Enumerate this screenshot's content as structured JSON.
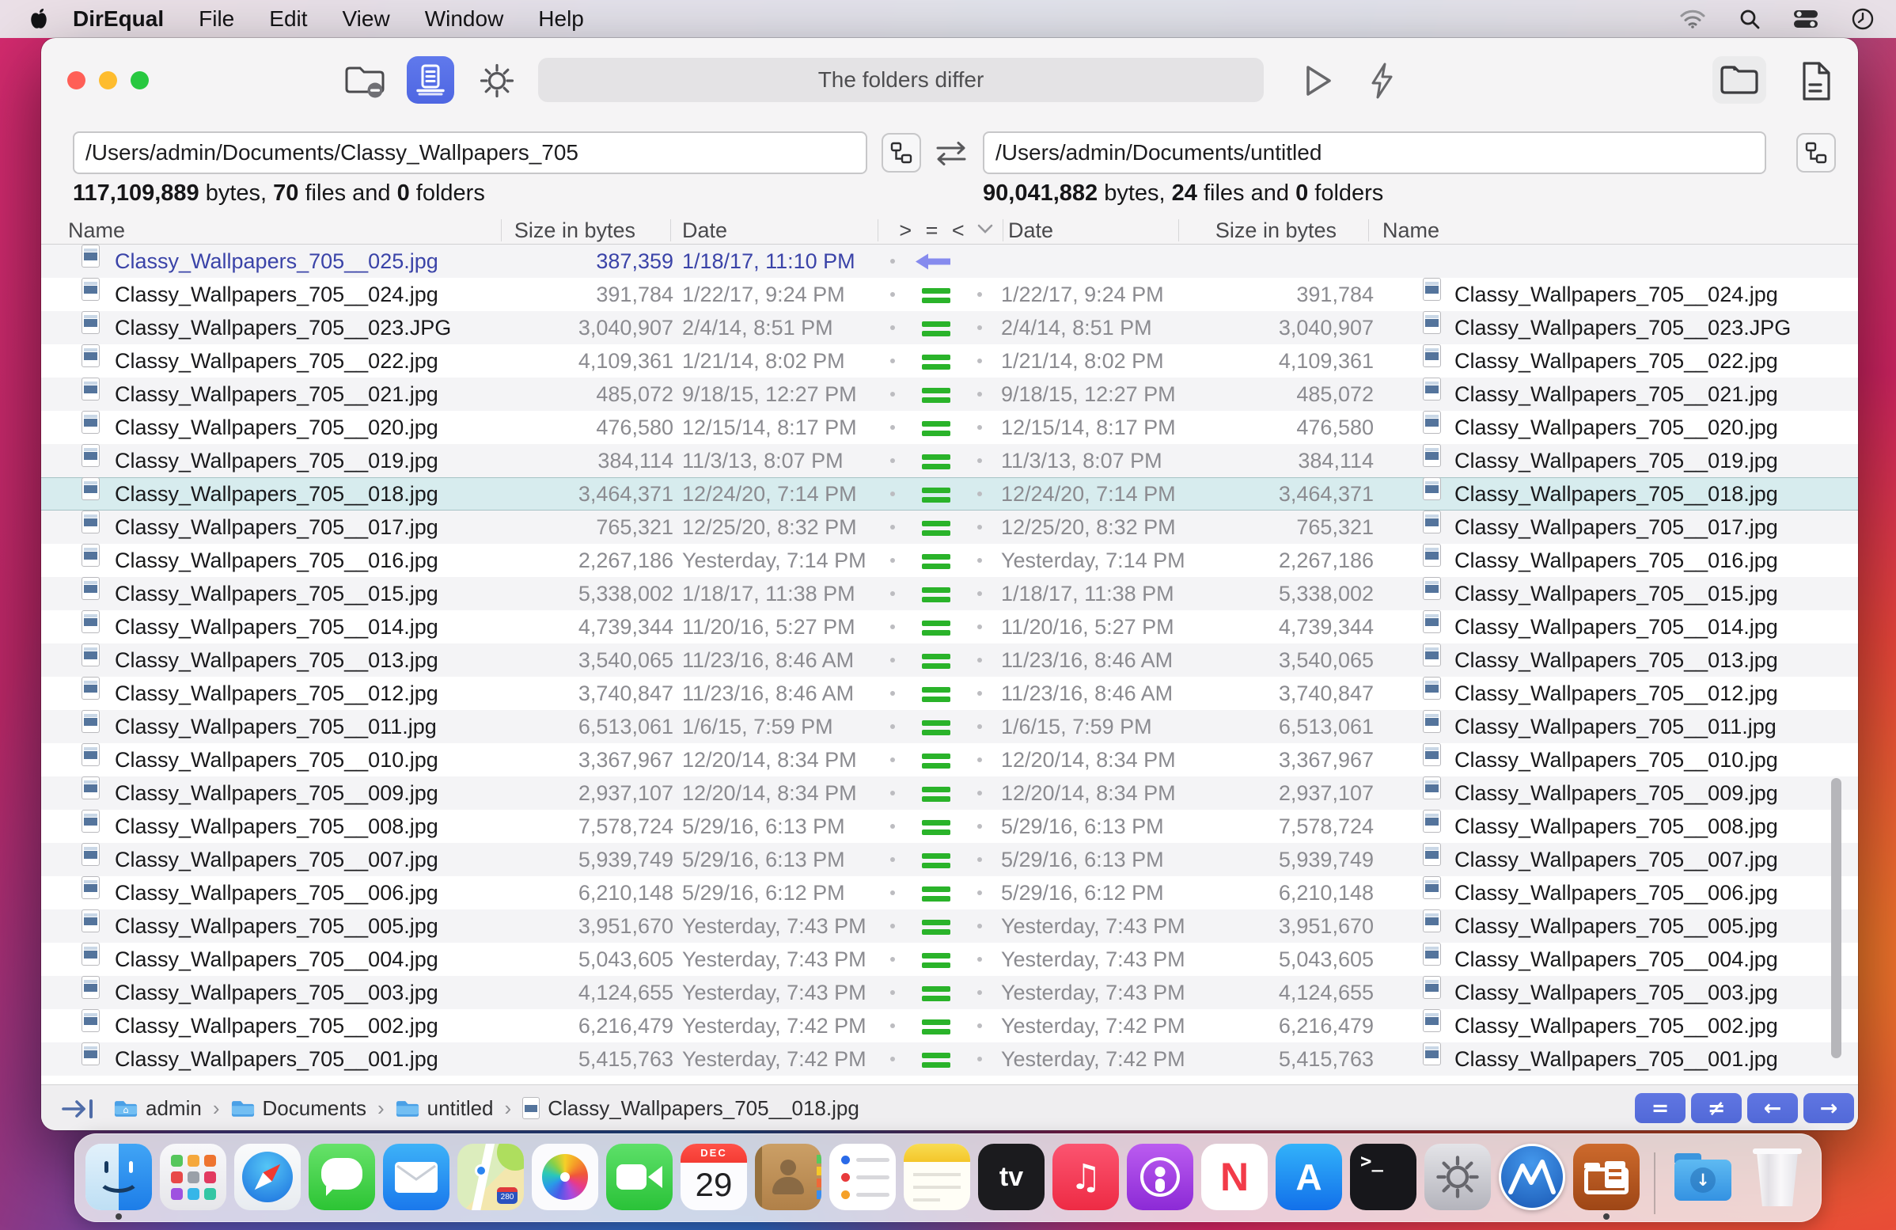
{
  "menu_bar": {
    "app_name": "DirEqual",
    "items": [
      "File",
      "Edit",
      "View",
      "Window",
      "Help"
    ],
    "status_icons": [
      "wifi-icon",
      "search-icon",
      "control-center-icon",
      "clock-icon"
    ]
  },
  "toolbar": {
    "status_text": "The folders differ",
    "icons": [
      "folder-minus-icon",
      "scan-compare-icon",
      "gear-icon",
      "play-icon",
      "lightning-icon",
      "open-folder-icon",
      "report-document-icon"
    ]
  },
  "left_pane": {
    "path": "/Users/admin/Documents/Classy_Wallpapers_705",
    "stats": {
      "bytes": "117,109,889",
      "files": "70",
      "folders": "0"
    }
  },
  "right_pane": {
    "path": "/Users/admin/Documents/untitled",
    "stats": {
      "bytes": "90,041,882",
      "files": "24",
      "folders": "0"
    }
  },
  "stats_words": {
    "bytes": "bytes,",
    "files": "files and",
    "folders": "folders"
  },
  "table": {
    "left_headers": [
      "Name",
      "Size in bytes",
      "Date"
    ],
    "compare_header": "> = <",
    "right_headers": [
      "Date",
      "Size in bytes",
      "Name"
    ],
    "rows": [
      {
        "name": "Classy_Wallpapers_705__025.jpg",
        "size": "387,359",
        "date": "1/18/17, 11:10 PM",
        "status": "left-only",
        "selected": false
      },
      {
        "name": "Classy_Wallpapers_705__024.jpg",
        "size": "391,784",
        "date": "1/22/17, 9:24 PM",
        "status": "equal",
        "selected": false
      },
      {
        "name": "Classy_Wallpapers_705__023.JPG",
        "size": "3,040,907",
        "date": "2/4/14, 8:51 PM",
        "status": "equal",
        "selected": false
      },
      {
        "name": "Classy_Wallpapers_705__022.jpg",
        "size": "4,109,361",
        "date": "1/21/14, 8:02 PM",
        "status": "equal",
        "selected": false
      },
      {
        "name": "Classy_Wallpapers_705__021.jpg",
        "size": "485,072",
        "date": "9/18/15, 12:27 PM",
        "status": "equal",
        "selected": false
      },
      {
        "name": "Classy_Wallpapers_705__020.jpg",
        "size": "476,580",
        "date": "12/15/14, 8:17 PM",
        "status": "equal",
        "selected": false
      },
      {
        "name": "Classy_Wallpapers_705__019.jpg",
        "size": "384,114",
        "date": "11/3/13, 8:07 PM",
        "status": "equal",
        "selected": false
      },
      {
        "name": "Classy_Wallpapers_705__018.jpg",
        "size": "3,464,371",
        "date": "12/24/20, 7:14 PM",
        "status": "equal",
        "selected": true
      },
      {
        "name": "Classy_Wallpapers_705__017.jpg",
        "size": "765,321",
        "date": "12/25/20, 8:32 PM",
        "status": "equal",
        "selected": false
      },
      {
        "name": "Classy_Wallpapers_705__016.jpg",
        "size": "2,267,186",
        "date": "Yesterday, 7:14 PM",
        "status": "equal",
        "selected": false
      },
      {
        "name": "Classy_Wallpapers_705__015.jpg",
        "size": "5,338,002",
        "date": "1/18/17, 11:38 PM",
        "status": "equal",
        "selected": false
      },
      {
        "name": "Classy_Wallpapers_705__014.jpg",
        "size": "4,739,344",
        "date": "11/20/16, 5:27 PM",
        "status": "equal",
        "selected": false
      },
      {
        "name": "Classy_Wallpapers_705__013.jpg",
        "size": "3,540,065",
        "date": "11/23/16, 8:46 AM",
        "status": "equal",
        "selected": false
      },
      {
        "name": "Classy_Wallpapers_705__012.jpg",
        "size": "3,740,847",
        "date": "11/23/16, 8:46 AM",
        "status": "equal",
        "selected": false
      },
      {
        "name": "Classy_Wallpapers_705__011.jpg",
        "size": "6,513,061",
        "date": "1/6/15, 7:59 PM",
        "status": "equal",
        "selected": false
      },
      {
        "name": "Classy_Wallpapers_705__010.jpg",
        "size": "3,367,967",
        "date": "12/20/14, 8:34 PM",
        "status": "equal",
        "selected": false
      },
      {
        "name": "Classy_Wallpapers_705__009.jpg",
        "size": "2,937,107",
        "date": "12/20/14, 8:34 PM",
        "status": "equal",
        "selected": false
      },
      {
        "name": "Classy_Wallpapers_705__008.jpg",
        "size": "7,578,724",
        "date": "5/29/16, 6:13 PM",
        "status": "equal",
        "selected": false
      },
      {
        "name": "Classy_Wallpapers_705__007.jpg",
        "size": "5,939,749",
        "date": "5/29/16, 6:13 PM",
        "status": "equal",
        "selected": false
      },
      {
        "name": "Classy_Wallpapers_705__006.jpg",
        "size": "6,210,148",
        "date": "5/29/16, 6:12 PM",
        "status": "equal",
        "selected": false
      },
      {
        "name": "Classy_Wallpapers_705__005.jpg",
        "size": "3,951,670",
        "date": "Yesterday, 7:43 PM",
        "status": "equal",
        "selected": false
      },
      {
        "name": "Classy_Wallpapers_705__004.jpg",
        "size": "5,043,605",
        "date": "Yesterday, 7:43 PM",
        "status": "equal",
        "selected": false
      },
      {
        "name": "Classy_Wallpapers_705__003.jpg",
        "size": "4,124,655",
        "date": "Yesterday, 7:43 PM",
        "status": "equal",
        "selected": false
      },
      {
        "name": "Classy_Wallpapers_705__002.jpg",
        "size": "6,216,479",
        "date": "Yesterday, 7:42 PM",
        "status": "equal",
        "selected": false
      },
      {
        "name": "Classy_Wallpapers_705__001.jpg",
        "size": "5,415,763",
        "date": "Yesterday, 7:42 PM",
        "status": "equal",
        "selected": false
      }
    ]
  },
  "status_bar": {
    "breadcrumb": [
      {
        "icon": "home-folder-icon",
        "label": "admin"
      },
      {
        "icon": "folder-icon",
        "label": "Documents"
      },
      {
        "icon": "folder-icon",
        "label": "untitled"
      },
      {
        "icon": "file-icon",
        "label": "Classy_Wallpapers_705__018.jpg"
      }
    ],
    "separator": "›",
    "buttons": [
      {
        "name": "filter-equal-button",
        "glyph": "="
      },
      {
        "name": "filter-not-equal-button",
        "glyph": "≠"
      },
      {
        "name": "copy-left-button",
        "glyph": "←"
      },
      {
        "name": "copy-right-button",
        "glyph": "→"
      }
    ]
  },
  "dock": {
    "items": [
      {
        "name": "finder",
        "label": "Finder",
        "running": true
      },
      {
        "name": "launchpad",
        "label": "Launchpad"
      },
      {
        "name": "safari",
        "label": "Safari"
      },
      {
        "name": "messages",
        "label": "Messages"
      },
      {
        "name": "mail",
        "label": "Mail"
      },
      {
        "name": "maps",
        "label": "Maps",
        "badge": "280"
      },
      {
        "name": "photos",
        "label": "Photos"
      },
      {
        "name": "facetime",
        "label": "FaceTime"
      },
      {
        "name": "calendar",
        "label": "Calendar",
        "month": "DEC",
        "day": "29"
      },
      {
        "name": "contacts",
        "label": "Contacts"
      },
      {
        "name": "reminders",
        "label": "Reminders"
      },
      {
        "name": "notes",
        "label": "Notes"
      },
      {
        "name": "tv",
        "label": "TV",
        "glyph": "tv"
      },
      {
        "name": "music",
        "label": "Music"
      },
      {
        "name": "podcasts",
        "label": "Podcasts"
      },
      {
        "name": "news",
        "label": "News",
        "glyph": "N"
      },
      {
        "name": "app-store",
        "label": "App Store",
        "glyph": "A"
      },
      {
        "name": "terminal",
        "label": "Terminal",
        "glyph": ">_"
      },
      {
        "name": "system-settings",
        "label": "System Settings"
      },
      {
        "name": "blue-mountain-app",
        "label": "Blue Mountain App"
      },
      {
        "name": "direqual",
        "label": "DirEqual",
        "running": true
      },
      {
        "name": "separator",
        "label": ""
      },
      {
        "name": "downloads",
        "label": "Downloads"
      },
      {
        "name": "trash",
        "label": "Trash"
      }
    ]
  },
  "colors": {
    "accent_blue": "#5269d8",
    "equal_green": "#2ab32a",
    "left_only_indigo": "#3a43a8",
    "selected_row": "#d7ecee"
  }
}
